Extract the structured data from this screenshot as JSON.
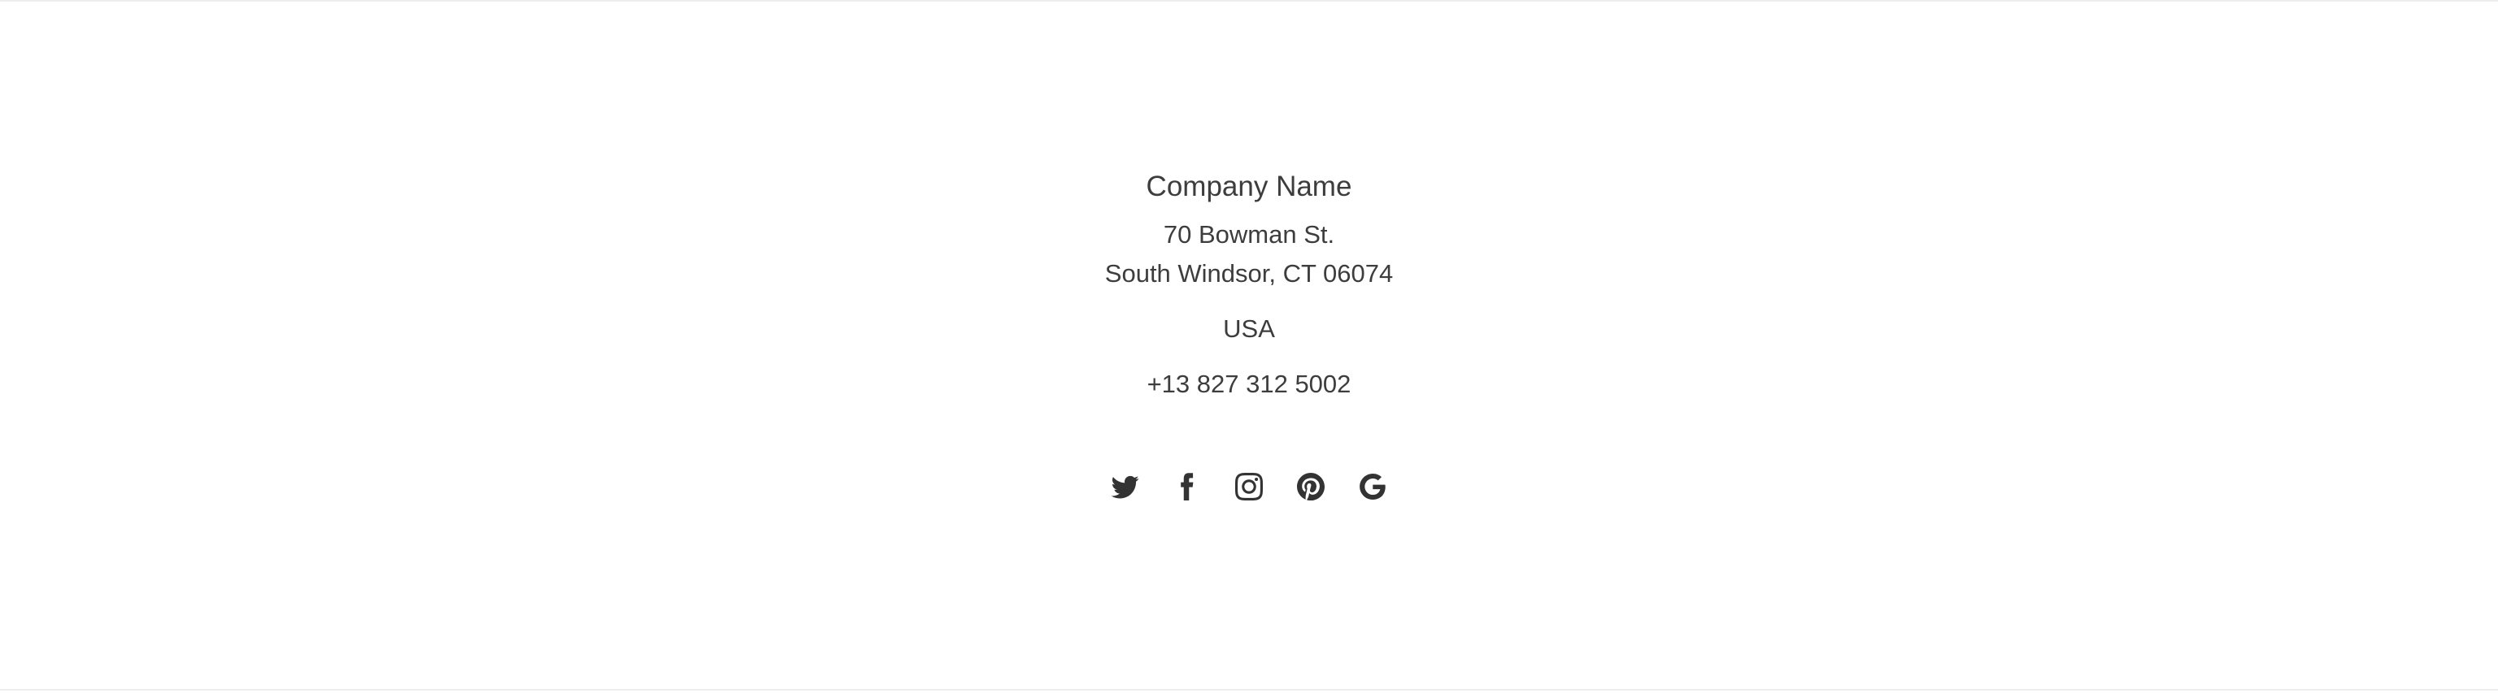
{
  "footer": {
    "company_name": "Company Name",
    "address_line1": "70 Bowman St.",
    "address_line2": "South Windsor, CT 06074",
    "country": "USA",
    "phone": "+13 827 312 5002"
  },
  "social": {
    "icons": [
      "twitter-icon",
      "facebook-icon",
      "instagram-icon",
      "pinterest-icon",
      "google-icon"
    ]
  },
  "colors": {
    "text": "#3d3d3d",
    "icon": "#333333",
    "border": "#ececec",
    "background": "#ffffff"
  }
}
